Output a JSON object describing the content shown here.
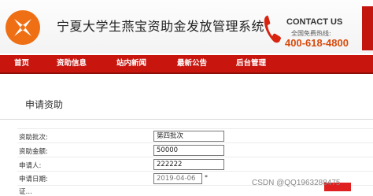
{
  "header": {
    "system_title": "宁夏大学生燕宝资助金发放管理系统",
    "contact_title": "CONTACT US",
    "hotline_label": "全国免费热线:",
    "hotline_number": "400-618-4800",
    "logo_color": "#ee6f14"
  },
  "nav": {
    "items": [
      {
        "label": "首页"
      },
      {
        "label": "资助信息"
      },
      {
        "label": "站内新闻"
      },
      {
        "label": "最新公告"
      },
      {
        "label": "后台管理"
      }
    ]
  },
  "page": {
    "title": "申请资助"
  },
  "form": {
    "batch": {
      "label": "资助批次:",
      "value": "第四批次"
    },
    "amount": {
      "label": "资助金额:",
      "value": "50000"
    },
    "applicant": {
      "label": "申请人:",
      "value": "222222"
    },
    "date": {
      "label": "申请日期:",
      "value": "2019-04-06",
      "required_mark": "*"
    },
    "next": {
      "label": "证…"
    }
  },
  "watermark": "CSDN @QQ1963288475",
  "colors": {
    "nav_bg": "#c8160f",
    "accent": "#e02020",
    "hotline": "#d84a0c"
  }
}
